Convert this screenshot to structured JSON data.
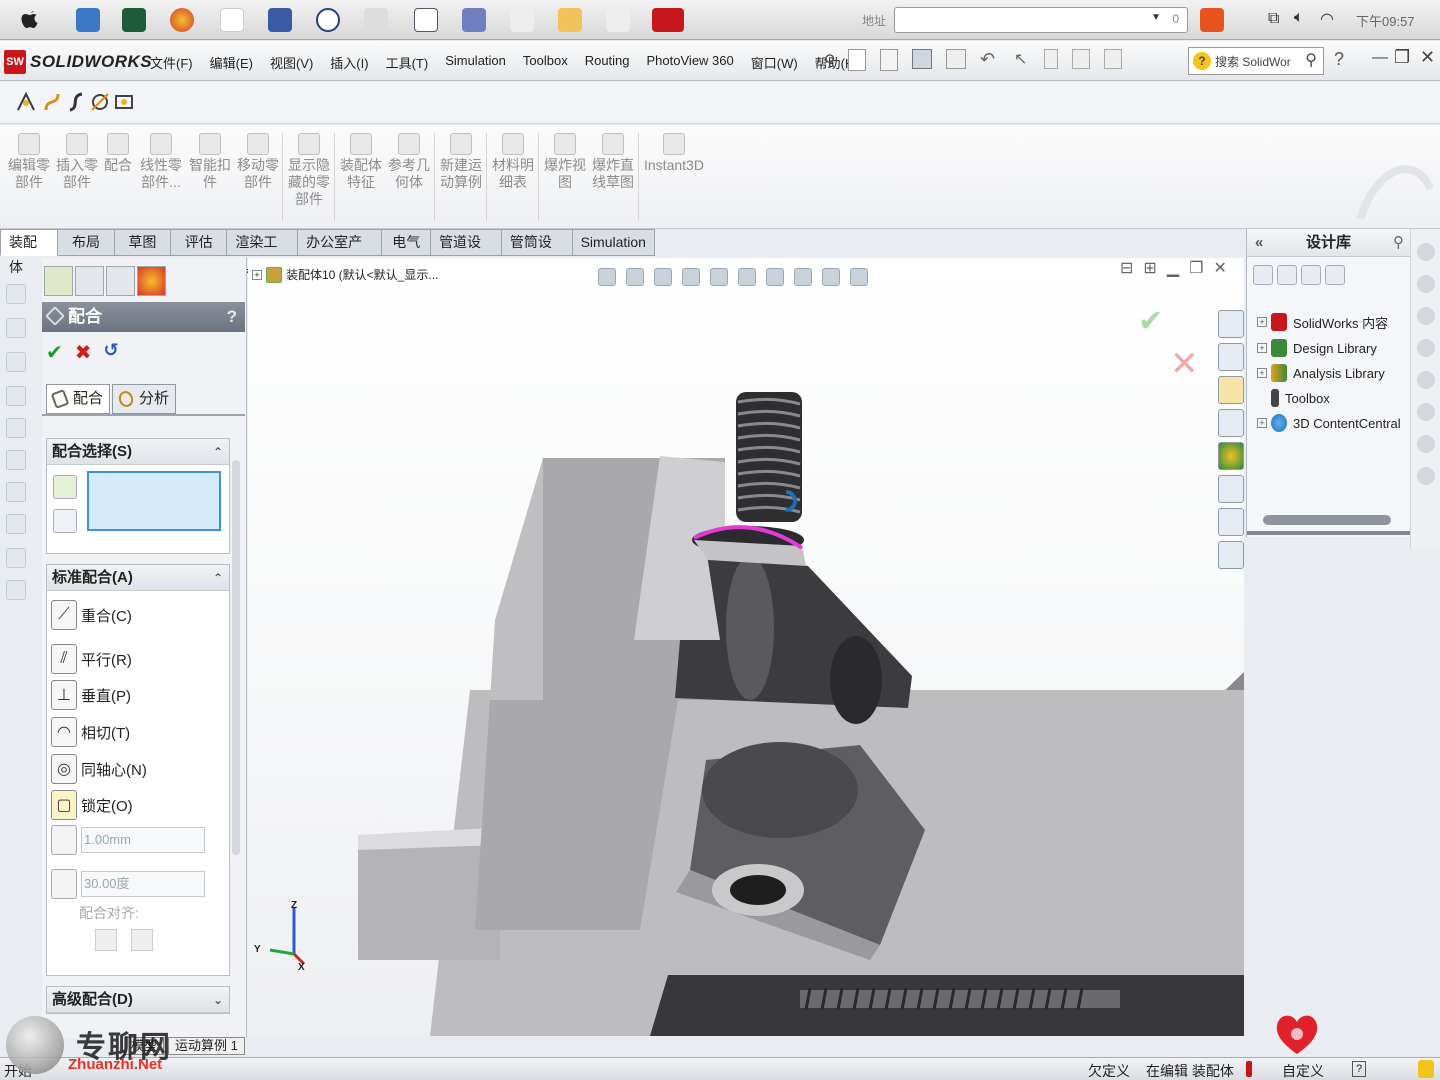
{
  "macbar": {
    "address_label": "地址",
    "clock": "下午09:57",
    "address_value": "",
    "address_zoom": "0"
  },
  "app": {
    "logo_mark": "SW",
    "logo_text": "SOLIDWORKS",
    "menus": [
      "文件(F)",
      "编辑(E)",
      "视图(V)",
      "插入(I)",
      "工具(T)",
      "Simulation",
      "Toolbox",
      "Routing",
      "PhotoView 360",
      "窗口(W)",
      "帮助(H)"
    ],
    "search_placeholder": "搜索 SolidWor"
  },
  "command_manager": {
    "buttons": [
      "编辑零\n部件",
      "插入零\n部件",
      "配合",
      "线性零\n部件...",
      "智能扣\n件",
      "移动零\n部件",
      "显示隐\n藏的零\n部件",
      "装配体\n特征",
      "参考几\n何体",
      "新建运\n动算例",
      "材料明\n细表",
      "爆炸视\n图",
      "爆炸直\n线草图",
      "Instant3D"
    ]
  },
  "tabs": [
    "装配体",
    "布局",
    "草图",
    "评估",
    "渲染工具",
    "办公室产品",
    "电气",
    "管道设计",
    "管筒设计",
    "Simulation"
  ],
  "property_manager": {
    "title": "配合",
    "help": "?",
    "subtabs": [
      "配合",
      "分析"
    ],
    "mate_selections": {
      "header": "配合选择(S)"
    },
    "standard_mates": {
      "header": "标准配合(A)",
      "items": [
        {
          "label": "重合(C)",
          "icon": "coincident-icon"
        },
        {
          "label": "平行(R)",
          "icon": "parallel-icon"
        },
        {
          "label": "垂直(P)",
          "icon": "perpendicular-icon"
        },
        {
          "label": "相切(T)",
          "icon": "tangent-icon"
        },
        {
          "label": "同轴心(N)",
          "icon": "concentric-icon"
        },
        {
          "label": "锁定(O)",
          "icon": "lock-icon"
        }
      ],
      "distance_value": "1.00mm",
      "angle_value": "30.00度",
      "mate_alignment": "配合对齐:"
    },
    "advanced_mates": {
      "header": "高级配合(D)"
    }
  },
  "graphics": {
    "tree_label": "装配体10 (默认<默认_显示..."
  },
  "design_library": {
    "title": "设计库",
    "items": [
      "SolidWorks 内容",
      "Design Library",
      "Analysis Library",
      "Toolbox",
      "3D ContentCentral"
    ],
    "colors": [
      "#c8161d",
      "#3b8a3a",
      "#e6a21a",
      "#444444",
      "#1f7fcf"
    ]
  },
  "bottom_tabs": [
    "模型",
    "运动算例 1"
  ],
  "status": {
    "left": "开始",
    "underdefined": "欠定义",
    "editing": "在编辑 装配体",
    "custom": "自定义",
    "help": "?"
  },
  "watermark": {
    "text": "专聊网",
    "url": "Zhuanzhi.Net"
  },
  "triad": {
    "z": "Z",
    "y": "Y",
    "x": "X"
  },
  "colors": {
    "accent_red": "#c8161d",
    "selection_blue": "#3e93d8",
    "ok_green": "#1e9b2a",
    "cancel_red": "#d21c1c",
    "highlight_magenta": "#e43ad8"
  }
}
